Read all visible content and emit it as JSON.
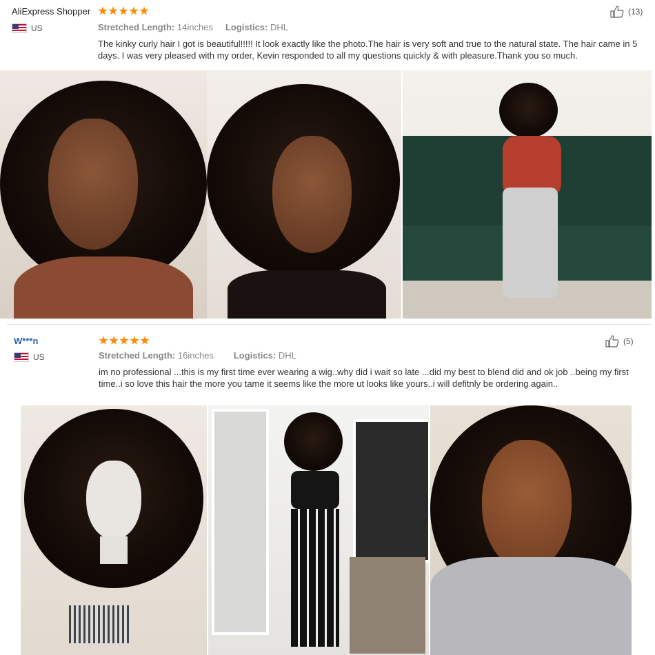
{
  "reviews": [
    {
      "user": "AliExpress Shopper",
      "country": "US",
      "rating": 5,
      "meta": {
        "length_label": "Stretched Length:",
        "length_value": "14inches",
        "logistics_label": "Logistics:",
        "logistics_value": "DHL"
      },
      "text": "The kinky curly hair I got is beautiful!!!!! It look exactly like the photo.The hair is very soft and true to the natural state. The hair came in 5 days. I was very pleased with my order, Kevin responded to all my questions quickly & with pleasure.Thank you so much.",
      "helpful_count": "(13)",
      "photos": [
        "photo-smiling-woman",
        "photo-woman-hand-on-chin",
        "photo-woman-on-green-sofa"
      ]
    },
    {
      "user": "W***n",
      "country": "US",
      "rating": 5,
      "meta": {
        "length_label": "Stretched Length:",
        "length_value": "16inches",
        "logistics_label": "Logistics:",
        "logistics_value": "DHL"
      },
      "text": "im no professional ...this is my first time ever wearing a wig..why did i wait so late ...did my best to blend did and ok job ..being my first time..i so love this hair the more you tame it seems like the more ut looks like yours..i will defitnly be ordering again..",
      "helpful_count": "(5)",
      "photos": [
        "photo-wig-on-mannequin",
        "photo-woman-full-body",
        "photo-woman-selfie"
      ]
    }
  ],
  "colors": {
    "star": "#ff8a00",
    "link": "#2a62b4",
    "divider": "#e3e3e3"
  },
  "icons": {
    "rating": "star-icon",
    "helpful": "thumbs-up-icon",
    "country": "us-flag-icon"
  }
}
